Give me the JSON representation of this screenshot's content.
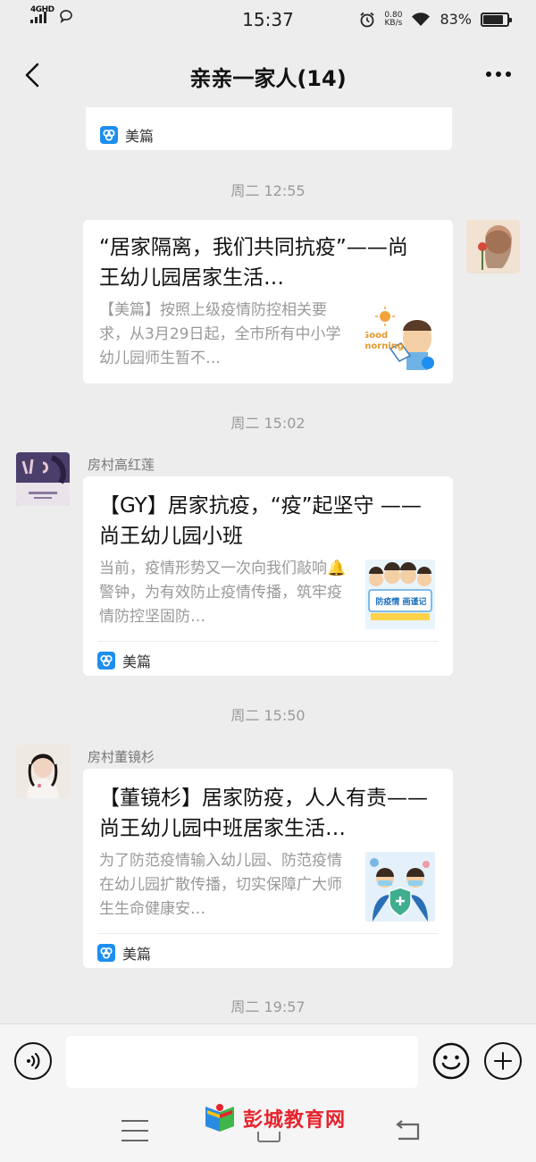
{
  "status_bar": {
    "network_label": "4GHD",
    "time": "15:37",
    "speed_value": "0.80",
    "speed_unit": "KB/s",
    "battery": "83%",
    "battery_level": 0.83
  },
  "header": {
    "title": "亲亲一家人(14)"
  },
  "messages": [
    {
      "type": "link_card_partial",
      "source": "美篇"
    },
    {
      "type": "time",
      "text": "周二 12:55"
    },
    {
      "type": "link_card",
      "direction": "outgoing",
      "title": "“居家隔离，我们共同抗疫”——尚王幼儿园居家生活…",
      "desc": "【美篇】按照上级疫情防控相关要求，从3月29日起，全市所有中小学幼儿园师生暂不…",
      "thumb_text": "Good morning"
    },
    {
      "type": "time",
      "text": "周二 15:02"
    },
    {
      "type": "link_card",
      "direction": "incoming",
      "sender": "房村高红莲",
      "title": "【GY】居家抗疫，“疫”起坚守 ——尚王幼儿园小班",
      "desc": "当前，疫情形势又一次向我们敲响🔔警钟，为有效防止疫情传播，筑牢疫情防控坚固防…",
      "thumb_text": "防疫情 画谨记",
      "source": "美篇"
    },
    {
      "type": "time",
      "text": "周二 15:50"
    },
    {
      "type": "link_card",
      "direction": "incoming",
      "sender": "房村董镜杉",
      "title": "【董镜杉】居家防疫，人人有责——尚王幼儿园中班居家生活…",
      "desc": "为了防范疫情输入幼儿园、防范疫情在幼儿园扩散传播，切实保障广大师生生命健康安…",
      "source": "美篇"
    },
    {
      "type": "time",
      "text": "周二 19:57"
    }
  ],
  "input": {
    "value": "",
    "placeholder": ""
  },
  "watermark": {
    "text": "彭城教育网"
  },
  "colors": {
    "background": "#ededed",
    "card": "#ffffff",
    "meipian_blue": "#1e8ef0",
    "watermark_red": "#e8232d"
  },
  "icons": [
    "back-arrow-icon",
    "more-icon",
    "voice-icon",
    "emoji-icon",
    "plus-icon",
    "meipian-logo-icon",
    "menu-icon",
    "home-icon",
    "return-icon"
  ]
}
